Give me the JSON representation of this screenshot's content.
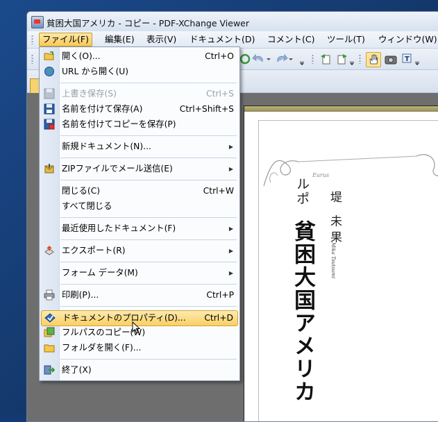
{
  "window": {
    "title": "貧困大国アメリカ - コピー - PDF-XChange Viewer"
  },
  "menubar": [
    {
      "label": "ファイル(F)",
      "active": true
    },
    {
      "label": "編集(E)"
    },
    {
      "label": "表示(V)"
    },
    {
      "label": "ドキュメント(D)"
    },
    {
      "label": "コメント(C)"
    },
    {
      "label": "ツール(T)"
    },
    {
      "label": "ウィンドウ(W)"
    }
  ],
  "file_menu": {
    "open": {
      "label": "開く(O)...",
      "shortcut": "Ctrl+O"
    },
    "open_url": {
      "label": "URL から開く(U)"
    },
    "overwrite_save": {
      "label": "上書き保存(S)",
      "shortcut": "Ctrl+S",
      "disabled": true
    },
    "save_as": {
      "label": "名前を付けて保存(A)",
      "shortcut": "Ctrl+Shift+S"
    },
    "save_copy_as": {
      "label": "名前を付けてコピーを保存(P)"
    },
    "new_document": {
      "label": "新規ドキュメント(N)..."
    },
    "zip_mail": {
      "label": "ZIPファイルでメール送信(E)"
    },
    "close": {
      "label": "閉じる(C)",
      "shortcut": "Ctrl+W"
    },
    "close_all": {
      "label": "すべて閉じる"
    },
    "recent": {
      "label": "最近使用したドキュメント(F)"
    },
    "export": {
      "label": "エクスポート(R)"
    },
    "form_data": {
      "label": "フォーム データ(M)"
    },
    "print": {
      "label": "印刷(P)...",
      "shortcut": "Ctrl+P"
    },
    "doc_properties": {
      "label": "ドキュメントのプロパティ(D)...",
      "shortcut": "Ctrl+D",
      "highlighted": true
    },
    "copy_full_path": {
      "label": "フルパスのコピー(W)"
    },
    "open_folder": {
      "label": "フォルダを開く(F)..."
    },
    "exit": {
      "label": "終了(X)"
    }
  },
  "document": {
    "author": "堤 未果",
    "author_roman": "Mika Tsutsumi",
    "series": "ルポ",
    "title": "貧困大国アメリカ",
    "ornament_text": "Eurus"
  },
  "colors": {
    "highlight": "#f9cf63",
    "menubar_active": "#f8c95a",
    "doc_bg": "#6e6e6e",
    "desktop": "#153a73"
  }
}
